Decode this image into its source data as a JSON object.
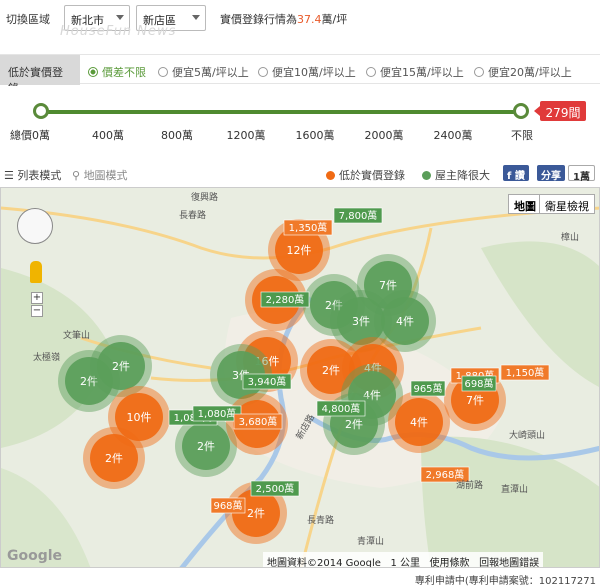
{
  "top": {
    "region_label": "切換區域",
    "city": "新北市",
    "district": "新店區",
    "price_prefix": "實價登錄行情為",
    "price_value": "37.4",
    "price_suffix": "萬/坪",
    "watermark": "HouseFun News"
  },
  "filter": {
    "tab_label": "低於實價登錄",
    "options": [
      "價差不限",
      "便宜5萬/坪以上",
      "便宜10萬/坪以上",
      "便宜15萬/坪以上",
      "便宜20萬/坪以上"
    ],
    "selected_index": 0
  },
  "slider": {
    "count": "279間",
    "ticks": [
      "總價0萬",
      "400萬",
      "800萬",
      "1200萬",
      "1600萬",
      "2000萬",
      "2400萬",
      "不限"
    ],
    "min_fraction": 0,
    "max_fraction": 1
  },
  "modes": {
    "list_label": "列表模式",
    "map_label": "地圖模式",
    "legend_orange": "低於實價登錄",
    "legend_green": "屋主降很大",
    "fb_label": "f 讚",
    "share_label": "分享",
    "count_label": "1萬"
  },
  "colors": {
    "orange": "#f06a14",
    "green": "#5b9e5a",
    "accent": "#e85a2a"
  },
  "map": {
    "maptype_map": "地圖",
    "maptype_sat": "衛星檢視",
    "google": "Google",
    "attribution": "地圖資料©2014 Google",
    "scale": "1 公里",
    "terms": "使用條款",
    "report": "回報地圖錯誤",
    "places": [
      "復興路",
      "長春路",
      "新店路",
      "文筆山",
      "太極嶺",
      "大崎頭山",
      "長青路",
      "青潭山",
      "直潭山",
      "湖前路",
      "樟山"
    ],
    "clusters": [
      {
        "c": "orange",
        "label": "12件"
      },
      {
        "c": "orange",
        "label": "2件"
      },
      {
        "c": "green",
        "label": "2件"
      },
      {
        "c": "green",
        "label": "7件"
      },
      {
        "c": "green",
        "label": "3件"
      },
      {
        "c": "green",
        "label": "4件"
      },
      {
        "c": "orange",
        "label": "16件"
      },
      {
        "c": "green",
        "label": "2件"
      },
      {
        "c": "green",
        "label": "2件"
      },
      {
        "c": "green",
        "label": "3件"
      },
      {
        "c": "orange",
        "label": "2件"
      },
      {
        "c": "orange",
        "label": "4件"
      },
      {
        "c": "green",
        "label": "4件"
      },
      {
        "c": "orange",
        "label": "10件"
      },
      {
        "c": "orange",
        "label": "2件"
      },
      {
        "c": "green",
        "label": "2件"
      },
      {
        "c": "orange",
        "label": "2件"
      },
      {
        "c": "green",
        "label": "2件"
      },
      {
        "c": "orange",
        "label": "4件"
      },
      {
        "c": "orange",
        "label": "7件"
      },
      {
        "c": "orange",
        "label": "2件"
      }
    ],
    "tags": [
      {
        "c": "orange",
        "label": "1,350萬"
      },
      {
        "c": "green",
        "label": "7,800萬"
      },
      {
        "c": "green",
        "label": "2,280萬"
      },
      {
        "c": "green",
        "label": "3,940萬"
      },
      {
        "c": "green",
        "label": "1,080萬"
      },
      {
        "c": "green",
        "label": "1,080萬"
      },
      {
        "c": "orange",
        "label": "3,680萬"
      },
      {
        "c": "green",
        "label": "4,800萬"
      },
      {
        "c": "green",
        "label": "965萬"
      },
      {
        "c": "orange",
        "label": "1,880萬"
      },
      {
        "c": "green",
        "label": "698萬"
      },
      {
        "c": "orange",
        "label": "1,150萬"
      },
      {
        "c": "orange",
        "label": "2,968萬"
      },
      {
        "c": "green",
        "label": "2,500萬"
      },
      {
        "c": "orange",
        "label": "968萬"
      }
    ]
  },
  "footer": "專利申請中(專利申請案號：102117271"
}
